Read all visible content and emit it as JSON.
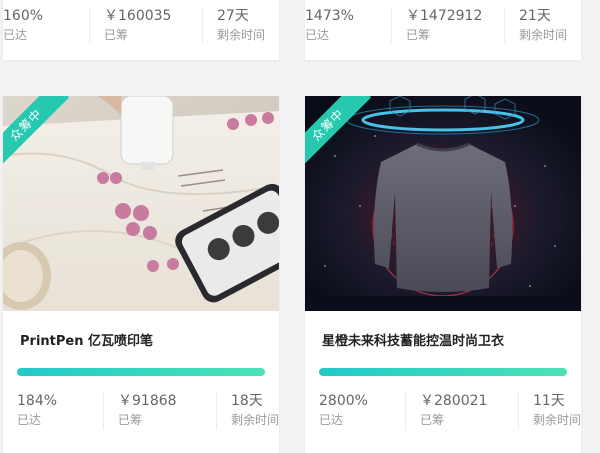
{
  "cards_top": [
    {
      "percent": "160%",
      "percent_label": "已达",
      "amount": "￥160035",
      "amount_label": "已筹",
      "days": "27天",
      "days_label": "剩余时间"
    },
    {
      "percent": "1473%",
      "percent_label": "已达",
      "amount": "￥1472912",
      "amount_label": "已筹",
      "days": "21天",
      "days_label": "剩余时间"
    }
  ],
  "cards_bottom": [
    {
      "badge": "众筹中",
      "title": "PrintPen 亿瓦喷印笔",
      "progress": 1.0,
      "percent": "184%",
      "percent_label": "已达",
      "amount": "￥91868",
      "amount_label": "已筹",
      "days": "18天",
      "days_label": "剩余时间"
    },
    {
      "badge": "众筹中",
      "title": "星橙未来科技蓄能控温时尚卫衣",
      "progress": 1.0,
      "percent": "2800%",
      "percent_label": "已达",
      "amount": "￥280021",
      "amount_label": "已筹",
      "days": "11天",
      "days_label": "剩余时间"
    }
  ],
  "colors": {
    "accent": "#26c9b0",
    "progress_start": "#21c9c9",
    "progress_end": "#4be3b4"
  }
}
